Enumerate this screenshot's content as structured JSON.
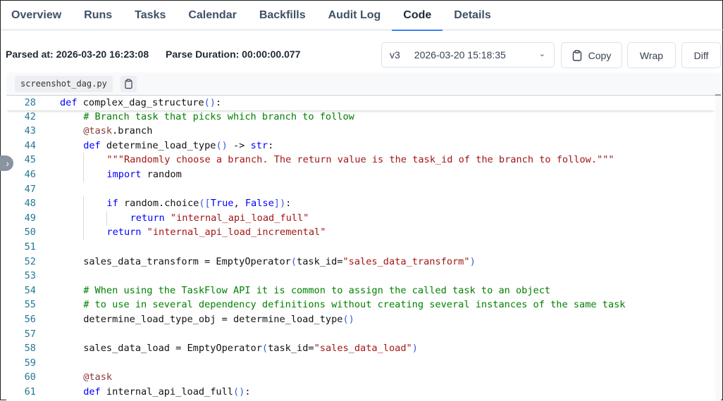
{
  "tabs": [
    "Overview",
    "Runs",
    "Tasks",
    "Calendar",
    "Backfills",
    "Audit Log",
    "Code",
    "Details"
  ],
  "active_tab": "Code",
  "info": {
    "parsed_at": "Parsed at: 2026-03-20 16:23:08",
    "parse_duration": "Parse Duration: 00:00:00.077"
  },
  "version_select": {
    "version": "v3",
    "timestamp": "2026-03-20 15:18:35"
  },
  "buttons": {
    "copy": "Copy",
    "wrap": "Wrap",
    "diff": "Diff"
  },
  "file": {
    "name": "screenshot_dag.py"
  },
  "colors": {
    "keyword": "#0000ff",
    "string": "#a31515",
    "comment": "#008000",
    "line_number": "#237893",
    "accent": "#3b82f6"
  },
  "code": {
    "sticky": {
      "n": "28",
      "indent": 0,
      "t": [
        [
          "kw",
          "def"
        ],
        [
          "pl",
          " complex_dag_structure"
        ],
        [
          "br",
          "()"
        ],
        [
          "pl",
          ":"
        ]
      ]
    },
    "lines": [
      {
        "n": "42",
        "indent": 1,
        "t": [
          [
            "cm",
            "# Branch task that picks which branch to follow"
          ]
        ]
      },
      {
        "n": "43",
        "indent": 1,
        "t": [
          [
            "dec",
            "@task"
          ],
          [
            "pl",
            ".branch"
          ]
        ]
      },
      {
        "n": "44",
        "indent": 1,
        "t": [
          [
            "kw",
            "def"
          ],
          [
            "pl",
            " determine_load_type"
          ],
          [
            "br",
            "()"
          ],
          [
            "pl",
            " -> "
          ],
          [
            "kw",
            "str"
          ],
          [
            "pl",
            ":"
          ]
        ]
      },
      {
        "n": "45",
        "indent": 2,
        "t": [
          [
            "str",
            "\"\"\"Randomly choose a branch. The return value is the task_id of the branch to follow.\"\"\""
          ]
        ]
      },
      {
        "n": "46",
        "indent": 2,
        "t": [
          [
            "kw",
            "import"
          ],
          [
            "pl",
            " random"
          ]
        ]
      },
      {
        "n": "47",
        "indent": 0,
        "t": []
      },
      {
        "n": "48",
        "indent": 2,
        "t": [
          [
            "kw",
            "if"
          ],
          [
            "pl",
            " random.choice"
          ],
          [
            "br",
            "(["
          ],
          [
            "kw",
            "True"
          ],
          [
            "pl",
            ", "
          ],
          [
            "kw",
            "False"
          ],
          [
            "br",
            "])"
          ],
          [
            "pl",
            ":"
          ]
        ]
      },
      {
        "n": "49",
        "indent": 3,
        "t": [
          [
            "kw",
            "return"
          ],
          [
            "str",
            " \"internal_api_load_full\""
          ]
        ]
      },
      {
        "n": "50",
        "indent": 2,
        "t": [
          [
            "kw",
            "return"
          ],
          [
            "str",
            " \"internal_api_load_incremental\""
          ]
        ]
      },
      {
        "n": "51",
        "indent": 0,
        "t": []
      },
      {
        "n": "52",
        "indent": 1,
        "t": [
          [
            "pl",
            "sales_data_transform = EmptyOperator"
          ],
          [
            "br",
            "("
          ],
          [
            "pl",
            "task_id="
          ],
          [
            "str",
            "\"sales_data_transform\""
          ],
          [
            "br",
            ")"
          ]
        ]
      },
      {
        "n": "53",
        "indent": 0,
        "t": []
      },
      {
        "n": "54",
        "indent": 1,
        "t": [
          [
            "cm",
            "# When using the TaskFlow API it is common to assign the called task to an object"
          ]
        ]
      },
      {
        "n": "55",
        "indent": 1,
        "t": [
          [
            "cm",
            "# to use in several dependency definitions without creating several instances of the same task"
          ]
        ]
      },
      {
        "n": "56",
        "indent": 1,
        "t": [
          [
            "pl",
            "determine_load_type_obj = determine_load_type"
          ],
          [
            "br",
            "()"
          ]
        ]
      },
      {
        "n": "57",
        "indent": 0,
        "t": []
      },
      {
        "n": "58",
        "indent": 1,
        "t": [
          [
            "pl",
            "sales_data_load = EmptyOperator"
          ],
          [
            "br",
            "("
          ],
          [
            "pl",
            "task_id="
          ],
          [
            "str",
            "\"sales_data_load\""
          ],
          [
            "br",
            ")"
          ]
        ]
      },
      {
        "n": "59",
        "indent": 0,
        "t": []
      },
      {
        "n": "60",
        "indent": 1,
        "t": [
          [
            "dec",
            "@task"
          ]
        ]
      },
      {
        "n": "61",
        "indent": 1,
        "t": [
          [
            "kw",
            "def"
          ],
          [
            "pl",
            " internal_api_load_full"
          ],
          [
            "br",
            "()"
          ],
          [
            "pl",
            ":"
          ]
        ]
      }
    ]
  }
}
